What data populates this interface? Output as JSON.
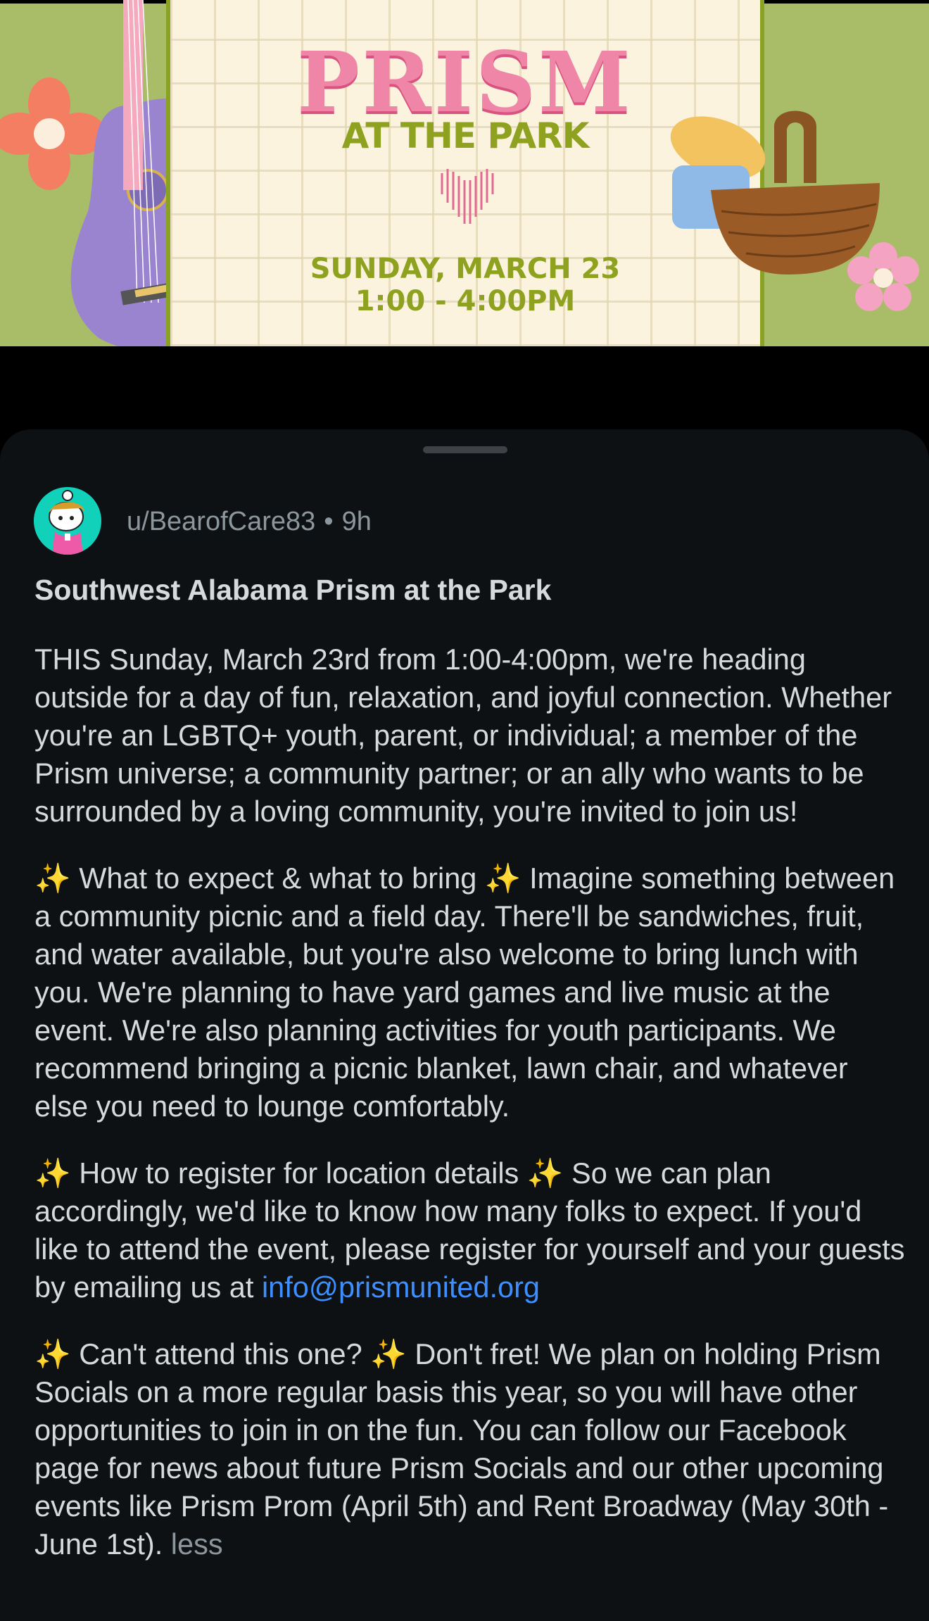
{
  "flyer": {
    "title": "PRISM",
    "subtitle": "AT THE PARK",
    "date": "SUNDAY, MARCH 23",
    "time": "1:00 - 4:00PM"
  },
  "post": {
    "author": "u/BearofCare83",
    "separator": "•",
    "age": "9h",
    "title": "Southwest Alabama Prism at the Park",
    "body": {
      "p1": "THIS Sunday, March 23rd from 1:00-4:00pm, we're heading outside for a day of fun, relaxation, and joyful connection. Whether you're an LGBTQ+ youth, parent, or individual; a member of the Prism universe; a community partner; or an ally who wants to be surrounded by a loving community, you're invited to join us!",
      "p2": "✨ What to expect & what to bring ✨ Imagine something between a community picnic and a field day. There'll be sandwiches, fruit, and water available, but you're also welcome to bring lunch with you. We're planning to have yard games and live music at the event. We're also planning activities for youth participants. We recommend bringing a picnic blanket, lawn chair, and whatever else you need to lounge comfortably.",
      "p3_text": "✨ How to register for location details ✨ So we can plan accordingly, we'd like to know how many folks to expect. If you'd like to attend the event, please register for yourself and your guests by emailing us at ",
      "p3_email": "info@prismunited.org",
      "p4_text": "✨ Can't attend this one? ✨ Don't fret! We plan on holding Prism Socials on a more regular basis this year, so you will have other opportunities to join in on the fun. You can follow our Facebook page for news about future Prism Socials and our other upcoming events like Prism Prom (April 5th) and Rent Broadway (May 30th - June 1st). ",
      "p4_less": "less"
    }
  },
  "colors": {
    "sheet_bg": "#0e1113",
    "text": "#d7dadc",
    "muted": "#8c979d",
    "link": "#3d8fff",
    "avatar_bg": "#11d1bb"
  },
  "icons": {
    "avatar": "snoo-avatar",
    "guitar": "guitar-illustration",
    "basket": "picnic-basket-illustration",
    "flower": "flower-illustration"
  }
}
